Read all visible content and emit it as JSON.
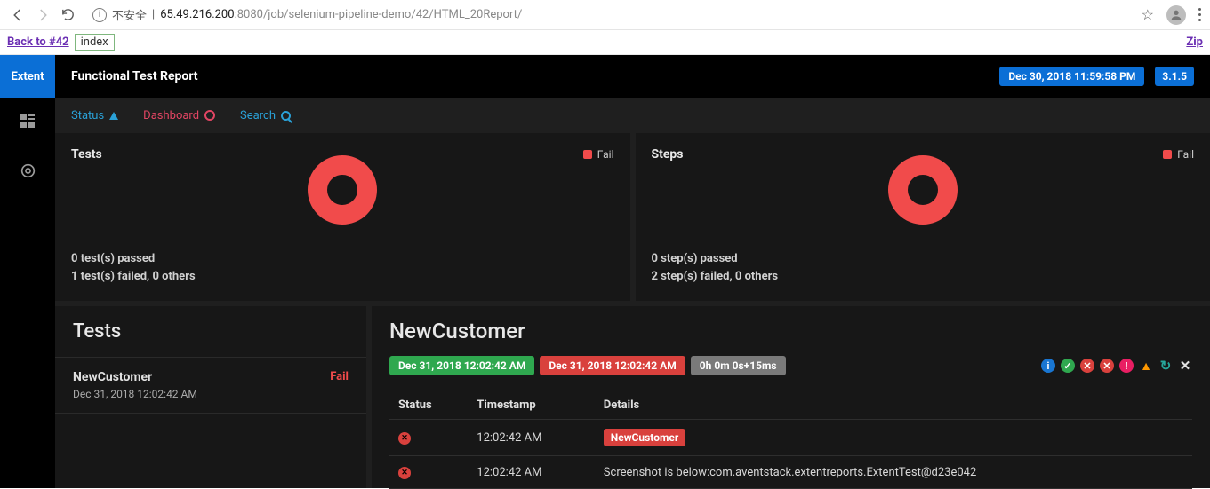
{
  "browser": {
    "insecure_label": "不安全",
    "url_host": "65.49.216.200",
    "url_port": ":8080",
    "url_path": "/job/selenium-pipeline-demo/42/HTML_20Report/"
  },
  "jenkins": {
    "back_label": "Back to #42",
    "index_label": "index",
    "zip_label": "Zip"
  },
  "header": {
    "brand": "Extent",
    "title": "Functional Test Report",
    "timestamp": "Dec 30, 2018 11:59:58 PM",
    "version": "3.1.5"
  },
  "nav": {
    "status": "Status",
    "dashboard": "Dashboard",
    "search": "Search"
  },
  "cards": {
    "tests": {
      "title": "Tests",
      "legend": "Fail",
      "line1": "0 test(s) passed",
      "line2": "1 test(s) failed, 0 others"
    },
    "steps": {
      "title": "Steps",
      "legend": "Fail",
      "line1": "0 step(s) passed",
      "line2": "2 step(s) failed, 0 others"
    }
  },
  "left": {
    "title": "Tests",
    "items": [
      {
        "name": "NewCustomer",
        "time": "Dec 31, 2018 12:02:42 AM",
        "status": "Fail"
      }
    ]
  },
  "detail": {
    "title": "NewCustomer",
    "start": "Dec 31, 2018 12:02:42 AM",
    "end": "Dec 31, 2018 12:02:42 AM",
    "duration": "0h 0m 0s+15ms",
    "columns": {
      "status": "Status",
      "timestamp": "Timestamp",
      "details": "Details"
    },
    "rows": [
      {
        "ts": "12:02:42 AM",
        "type": "chip",
        "text": "NewCustomer"
      },
      {
        "ts": "12:02:42 AM",
        "type": "text",
        "text": "Screenshot is below:com.aventstack.extentreports.ExtentTest@d23e042"
      }
    ]
  },
  "chart_data": [
    {
      "type": "pie",
      "title": "Tests",
      "series": [
        {
          "name": "Fail",
          "value": 1
        }
      ]
    },
    {
      "type": "pie",
      "title": "Steps",
      "series": [
        {
          "name": "Fail",
          "value": 2
        }
      ]
    }
  ]
}
